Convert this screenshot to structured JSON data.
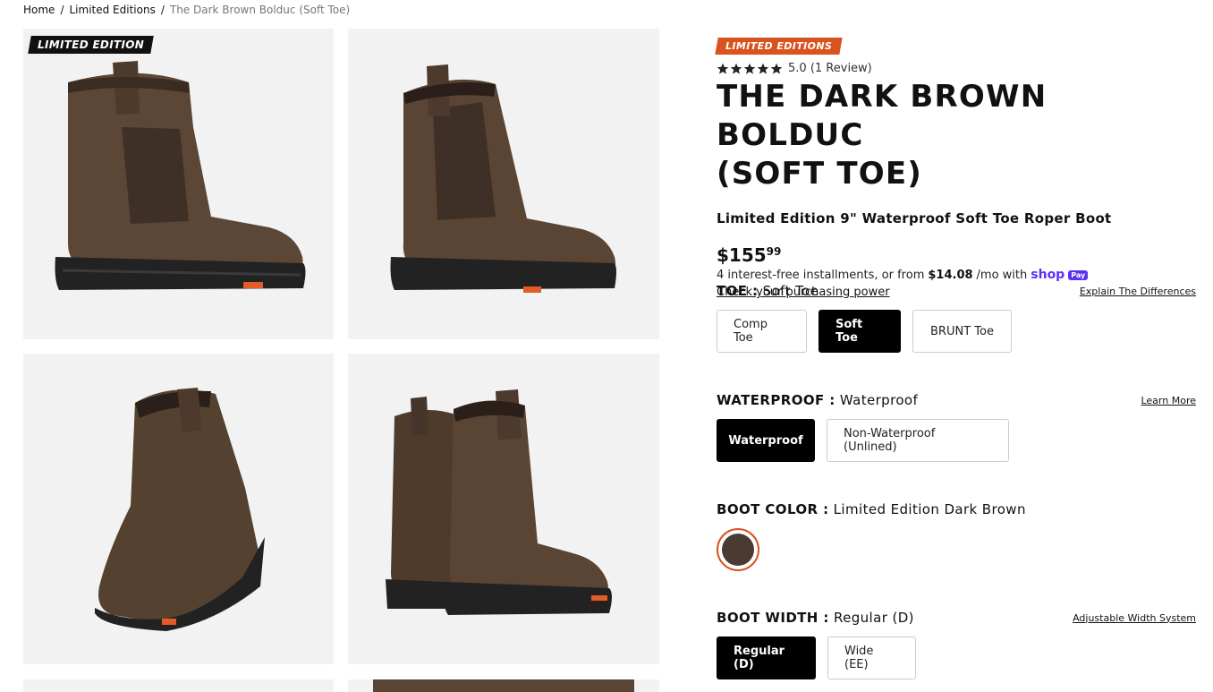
{
  "breadcrumb": {
    "home": "Home",
    "sep1": "/",
    "category": "Limited Editions",
    "sep2": "/",
    "current": "The Dark Brown Bolduc (Soft Toe)"
  },
  "gallery": {
    "badge": "LIMITED EDITION"
  },
  "product": {
    "badge": "LIMITED EDITIONS",
    "rating_value": "5.0",
    "review_count": "(1 Review)",
    "title_line1": "THE DARK BROWN BOLDUC",
    "title_line2": "(SOFT TOE)",
    "subtitle": "Limited Edition 9\" Waterproof Soft Toe Roper Boot",
    "price_dollars": "$155",
    "price_cents": "99",
    "installment_text": "4 interest-free installments, or from",
    "installment_amount": "$14.08",
    "installment_suffix": "/mo with",
    "shop_word": "shop",
    "pay_word": "Pay",
    "purchasing_link": "Check your purchasing power"
  },
  "options": {
    "toe": {
      "label": "TOE :",
      "value": "Soft Toe",
      "link": "Explain The Differences",
      "choices": [
        "Comp Toe",
        "Soft Toe",
        "BRUNT Toe"
      ]
    },
    "waterproof": {
      "label": "WATERPROOF :",
      "value": "Waterproof",
      "link": "Learn More",
      "choices": [
        "Waterproof",
        "Non-Waterproof (Unlined)"
      ]
    },
    "boot_color": {
      "label": "BOOT COLOR :",
      "value": "Limited Edition Dark Brown",
      "swatch_color": "#4a3a32"
    },
    "boot_width": {
      "label": "BOOT WIDTH :",
      "value": "Regular (D)",
      "link": "Adjustable Width System",
      "choices": [
        "Regular (D)",
        "Wide (EE)"
      ]
    }
  },
  "colors": {
    "accent_orange": "#d9531e",
    "shop_purple": "#5a31f4",
    "boot_brown": "#4a3a32"
  }
}
